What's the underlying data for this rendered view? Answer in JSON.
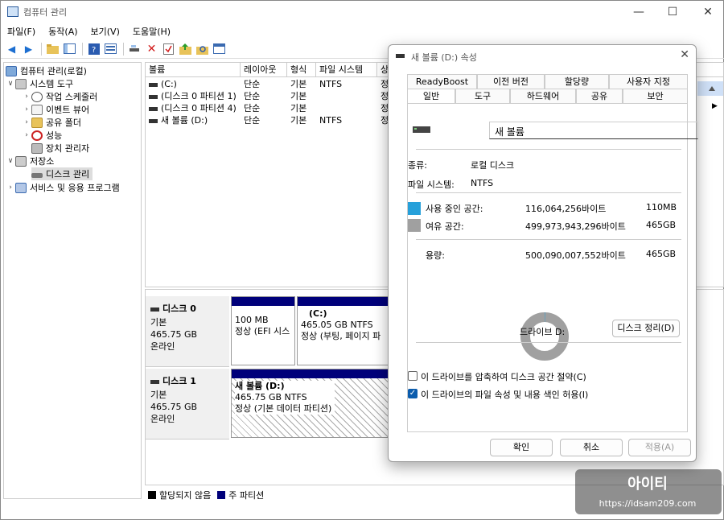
{
  "app": {
    "title": "컴퓨터 관리",
    "minimize": "—",
    "maximize": "☐",
    "close": "✕"
  },
  "menu": [
    "파일(F)",
    "동작(A)",
    "보기(V)",
    "도움말(H)"
  ],
  "tree": {
    "root": "컴퓨터 관리(로컬)",
    "system_tools": "시스템 도구",
    "task_scheduler": "작업 스케줄러",
    "event_viewer": "이벤트 뷰어",
    "shared_folders": "공유 폴더",
    "performance": "성능",
    "device_manager": "장치 관리자",
    "storage": "저장소",
    "disk_management": "디스크 관리",
    "services": "서비스 및 응용 프로그램"
  },
  "volume_list": {
    "headers": [
      "볼륨",
      "레이아웃",
      "형식",
      "파일 시스템",
      "상"
    ],
    "rows": [
      [
        "(C:)",
        "단순",
        "기본",
        "NTFS",
        "정"
      ],
      [
        "(디스크 0 파티션 1)",
        "단순",
        "기본",
        "",
        "정"
      ],
      [
        "(디스크 0 파티션 4)",
        "단순",
        "기본",
        "",
        "정"
      ],
      [
        "새 볼륨 (D:)",
        "단순",
        "기본",
        "NTFS",
        "정"
      ]
    ]
  },
  "disks": [
    {
      "name": "디스크 0",
      "type": "기본",
      "size": "465.75 GB",
      "status": "온라인",
      "parts": [
        {
          "title": "",
          "line1": "100 MB",
          "line2": "정상 (EFI 시스"
        },
        {
          "title": "(C:)",
          "line1": "465.05 GB NTFS",
          "line2": "정상 (부팅, 페이지 파"
        }
      ]
    },
    {
      "name": "디스크 1",
      "type": "기본",
      "size": "465.75 GB",
      "status": "온라인",
      "parts": [
        {
          "title": "새 볼륨  (D:)",
          "line1": "465.75 GB NTFS",
          "line2": "정상 (기본 데이터 파티션)"
        }
      ]
    }
  ],
  "legend": [
    "할당되지 않음",
    "주 파티션"
  ],
  "dialog": {
    "title": "새 볼륨 (D:) 속성",
    "close": "✕",
    "tabs_row1": [
      "ReadyBoost",
      "이전 버전",
      "할당량",
      "사용자 지정"
    ],
    "tabs_row2": [
      "일반",
      "도구",
      "하드웨어",
      "공유",
      "보안"
    ],
    "volume_name": "새 볼륨",
    "type_label": "종류:",
    "type_value": "로컬 디스크",
    "fs_label": "파일 시스템:",
    "fs_value": "NTFS",
    "used_label": "사용 중인 공간:",
    "used_bytes": "116,064,256바이트",
    "used_size": "110MB",
    "free_label": "여유 공간:",
    "free_bytes": "499,973,943,296바이트",
    "free_size": "465GB",
    "cap_label": "용량:",
    "cap_bytes": "500,090,007,552바이트",
    "cap_size": "465GB",
    "drive_label": "드라이브 D:",
    "cleanup": "디스크 정리(D)",
    "compress": "이 드라이브를 압축하여 디스크 공간 절약(C)",
    "index": "이 드라이브의 파일 속성 및 내용 색인 허용(I)",
    "ok": "확인",
    "cancel": "취소",
    "apply": "적용(A)",
    "used_fraction": 0.000232,
    "colors": {
      "used": "#26a0da",
      "free": "#a0a0a0"
    }
  },
  "watermark": {
    "brand": "아이티",
    "url": "https://idsam209.com"
  }
}
